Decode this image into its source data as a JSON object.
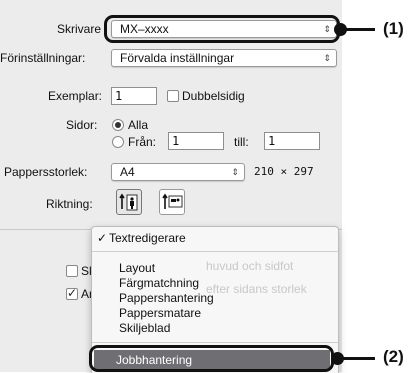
{
  "printer": {
    "label": "Skrivare",
    "value": "MX–xxxx"
  },
  "presets": {
    "label": "Förinställningar:",
    "value": "Förvalda inställningar"
  },
  "copies": {
    "label": "Exemplar:",
    "value": "1",
    "duplex_label": "Dubbelsidig"
  },
  "pages": {
    "label": "Sidor:",
    "all_label": "Alla",
    "from_label": "Från:",
    "from_value": "1",
    "to_label": "till:",
    "to_value": "1"
  },
  "paper": {
    "label": "Pappersstorlek:",
    "value": "A4",
    "dims": "210 × 297"
  },
  "orientation": {
    "label": "Riktning:"
  },
  "behind": {
    "skriv": "Skriv",
    "skriv_tail": "huvud och sidfot",
    "anpa": "Anpa",
    "anpa_tail": "efter sidans storlek"
  },
  "menu": {
    "checked_item": "Textredigerare",
    "items": [
      "Layout",
      "Färgmatchning",
      "Pappershantering",
      "Pappersmatare",
      "Skiljeblad"
    ],
    "highlighted_item": "Jobbhantering"
  },
  "callouts": {
    "one": "(1)",
    "two": "(2)"
  }
}
